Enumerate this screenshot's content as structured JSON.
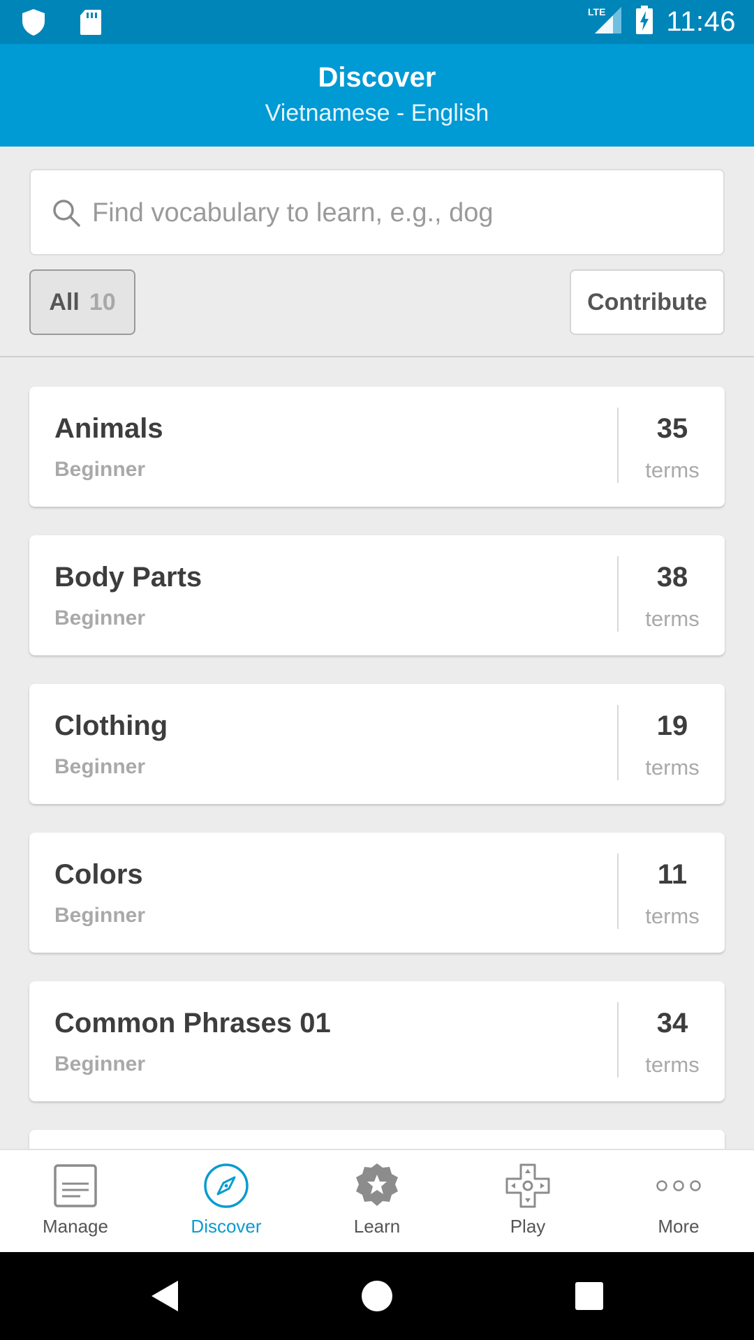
{
  "status_bar": {
    "time": "11:46",
    "network": "LTE"
  },
  "header": {
    "title": "Discover",
    "subtitle": "Vietnamese - English"
  },
  "search": {
    "placeholder": "Find vocabulary to learn, e.g., dog",
    "value": ""
  },
  "filter": {
    "label": "All",
    "count": "10"
  },
  "contribute_label": "Contribute",
  "cards": [
    {
      "title": "Animals",
      "level": "Beginner",
      "count": "35",
      "unit": "terms"
    },
    {
      "title": "Body Parts",
      "level": "Beginner",
      "count": "38",
      "unit": "terms"
    },
    {
      "title": "Clothing",
      "level": "Beginner",
      "count": "19",
      "unit": "terms"
    },
    {
      "title": "Colors",
      "level": "Beginner",
      "count": "11",
      "unit": "terms"
    },
    {
      "title": "Common Phrases 01",
      "level": "Beginner",
      "count": "34",
      "unit": "terms"
    }
  ],
  "nav": [
    {
      "label": "Manage",
      "icon": "manage-icon"
    },
    {
      "label": "Discover",
      "icon": "compass-icon",
      "active": true
    },
    {
      "label": "Learn",
      "icon": "star-badge-icon"
    },
    {
      "label": "Play",
      "icon": "gamepad-icon"
    },
    {
      "label": "More",
      "icon": "more-dots-icon"
    }
  ],
  "colors": {
    "header": "#009ad5",
    "status_bar": "#0085b9",
    "accent": "#0a9bd0"
  }
}
